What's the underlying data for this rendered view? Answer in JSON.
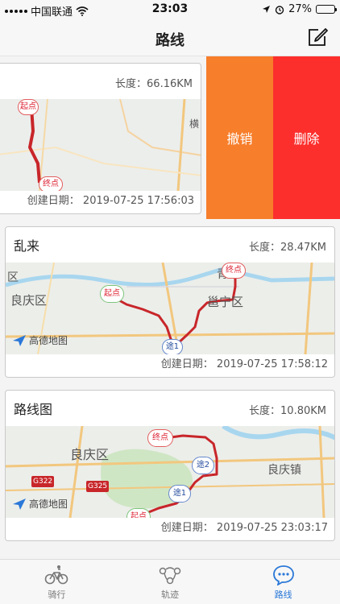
{
  "status_bar": {
    "carrier": "中国联通",
    "time": "23:03",
    "battery_percent": "27%",
    "battery_level": 0.27
  },
  "header": {
    "title": "路线"
  },
  "swipe_actions": {
    "undo_label": "撤销",
    "delete_label": "删除"
  },
  "routes": [
    {
      "title": "",
      "length": "长度：66.16KM",
      "created": "创建日期： 2019-07-25 17:56:03",
      "map": {
        "start": "起点",
        "end": "终点",
        "place": "横"
      }
    },
    {
      "title": "乱来",
      "length": "长度：28.47KM",
      "created": "创建日期： 2019-07-25 17:58:12",
      "map": {
        "start": "起点",
        "end": "终点",
        "via1": "途1",
        "district1": "良庆区",
        "district2": "邕宁区",
        "district_partial": "区",
        "place_partial": "青",
        "logo": "高德地图"
      }
    },
    {
      "title": "路线图",
      "length": "长度：10.80KM",
      "created": "创建日期： 2019-07-25 23:03:17",
      "map": {
        "start": "起点",
        "end": "终点",
        "via1": "途1",
        "via2": "途2",
        "district1": "良庆区",
        "town": "良庆镇",
        "road1": "G322",
        "road2": "G325",
        "logo": "高德地图"
      }
    }
  ],
  "tabbar": {
    "tabs": [
      {
        "label": "骑行",
        "icon": "bicycle-icon",
        "active": false
      },
      {
        "label": "轨迹",
        "icon": "track-icon",
        "active": false
      },
      {
        "label": "路线",
        "icon": "chat-bubble-icon",
        "active": true
      }
    ],
    "active_color": "#2a78d8"
  },
  "colors": {
    "undo": "#f77e2b",
    "delete": "#fc2f2d",
    "route_line": "#c8262a"
  }
}
